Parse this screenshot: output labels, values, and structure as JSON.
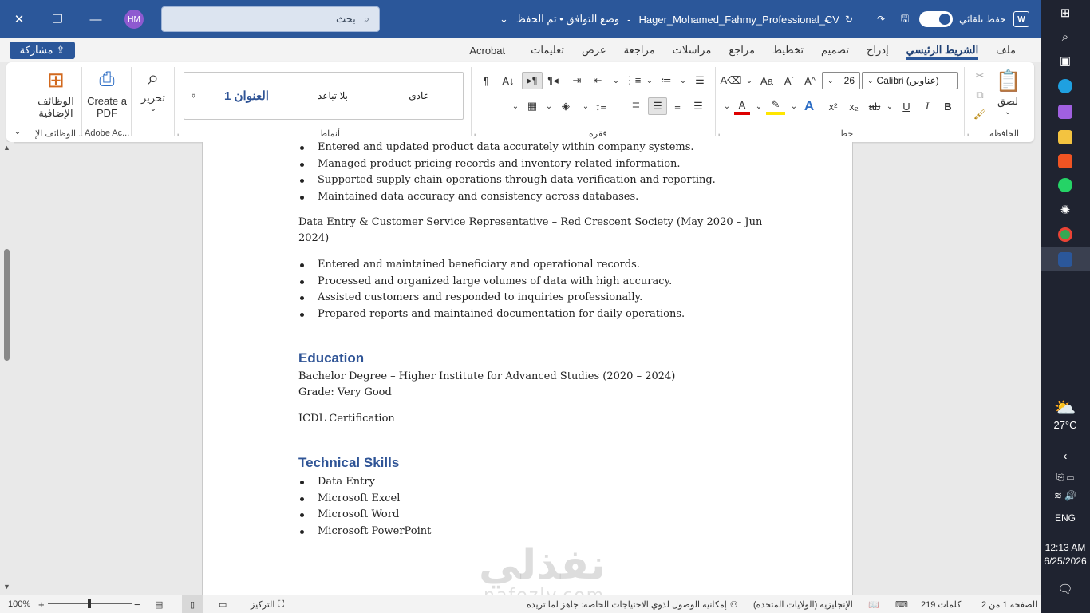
{
  "titlebar": {
    "close": "✕",
    "restore": "❐",
    "minimize": "—",
    "avatar": "HM",
    "search_placeholder": "بحث",
    "doc_title": "Hager_Mohamed_Fahmy_Professional_CV",
    "compat_status": "وضع التوافق • تم الحفظ",
    "autosave_label": "حفظ تلقائي"
  },
  "tabs": {
    "share": "مشاركة",
    "items": [
      "ملف",
      "الشريط الرئيسي",
      "إدراج",
      "تصميم",
      "تخطيط",
      "مراجع",
      "مراسلات",
      "مراجعة",
      "عرض",
      "تعليمات",
      "Acrobat"
    ]
  },
  "ribbon": {
    "clipboard": {
      "label": "الحافظة",
      "paste": "لصق"
    },
    "font": {
      "label": "خط",
      "family": "Calibri (عناوين)",
      "size": "26"
    },
    "paragraph": {
      "label": "فقرة"
    },
    "styles": {
      "label": "أنماط",
      "normal": "عادي",
      "no_spacing": "بلا تباعد",
      "heading1": "العنوان 1"
    },
    "editing": {
      "label": "تحرير"
    },
    "adobe": {
      "label": "Adobe Ac...",
      "create": "Create a PDF"
    },
    "addins": {
      "label": "الوظائف الإ...",
      "btn": "الوظائف الإضافية"
    }
  },
  "document": {
    "bullets1": [
      "Entered and updated product data accurately within company systems.",
      "Managed product pricing records and inventory-related information.",
      "Supported supply chain operations through data verification and reporting.",
      "Maintained data accuracy and consistency across databases."
    ],
    "job2_line1": "Data Entry & Customer Service Representative – Red Crescent Society (May 2020 – Jun",
    "job2_line2": "2024)",
    "bullets2": [
      "Entered and maintained beneficiary and operational records.",
      "Processed and organized large volumes of data with high accuracy.",
      "Assisted customers and responded to inquiries professionally.",
      "Prepared reports and maintained documentation for daily operations."
    ],
    "education_heading": "Education",
    "degree": "Bachelor Degree – Higher Institute for Advanced Studies (2020 – 2024)",
    "grade": "Grade: Very Good",
    "icdl": "ICDL Certification",
    "skills_heading": "Technical Skills",
    "skills": [
      "Data Entry",
      "Microsoft Excel",
      "Microsoft Word",
      "Microsoft PowerPoint"
    ],
    "watermark": "نفذلي",
    "watermark_sub": "nafezly.com"
  },
  "statusbar": {
    "page": "الصفحة 1 من 2",
    "words": "219 كلمات",
    "language": "الإنجليزية (الولايات المتحدة)",
    "accessibility": "إمكانية الوصول لذوي الاحتياجات الخاصة: جاهز لما تريده",
    "focus": "التركيز",
    "zoom": "100%"
  },
  "taskbar": {
    "temp": "27°C",
    "lang": "ENG",
    "time": "12:13 AM",
    "date": "6/25/2026"
  }
}
